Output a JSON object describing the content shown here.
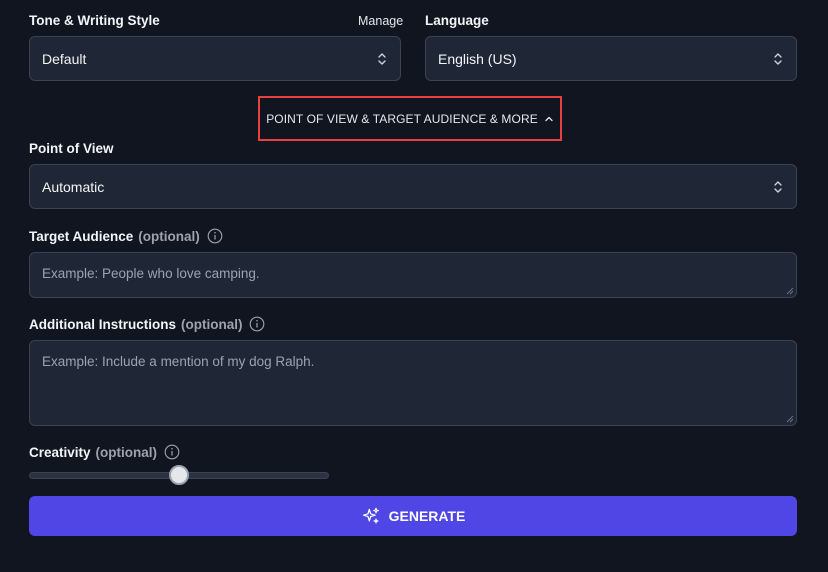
{
  "tone": {
    "label": "Tone & Writing Style",
    "manage_label": "Manage",
    "value": "Default"
  },
  "language": {
    "label": "Language",
    "value": "English (US)"
  },
  "toggle": {
    "label": "POINT OF VIEW & TARGET AUDIENCE & MORE",
    "icon": "chevron-up-icon"
  },
  "point_of_view": {
    "label": "Point of View",
    "value": "Automatic"
  },
  "target_audience": {
    "label": "Target Audience",
    "optional": "(optional)",
    "placeholder": "Example: People who love camping."
  },
  "additional_instructions": {
    "label": "Additional Instructions",
    "optional": "(optional)",
    "placeholder": "Example: Include a mention of my dog Ralph."
  },
  "creativity": {
    "label": "Creativity",
    "optional": "(optional)",
    "level": 0.5
  },
  "generate": {
    "label": "GENERATE",
    "icon": "sparkles-icon"
  },
  "colors": {
    "background": "#111520",
    "field": "#1f2636",
    "border": "#3a4253",
    "accent": "#4f46e5",
    "highlight_border": "#e5413f"
  }
}
